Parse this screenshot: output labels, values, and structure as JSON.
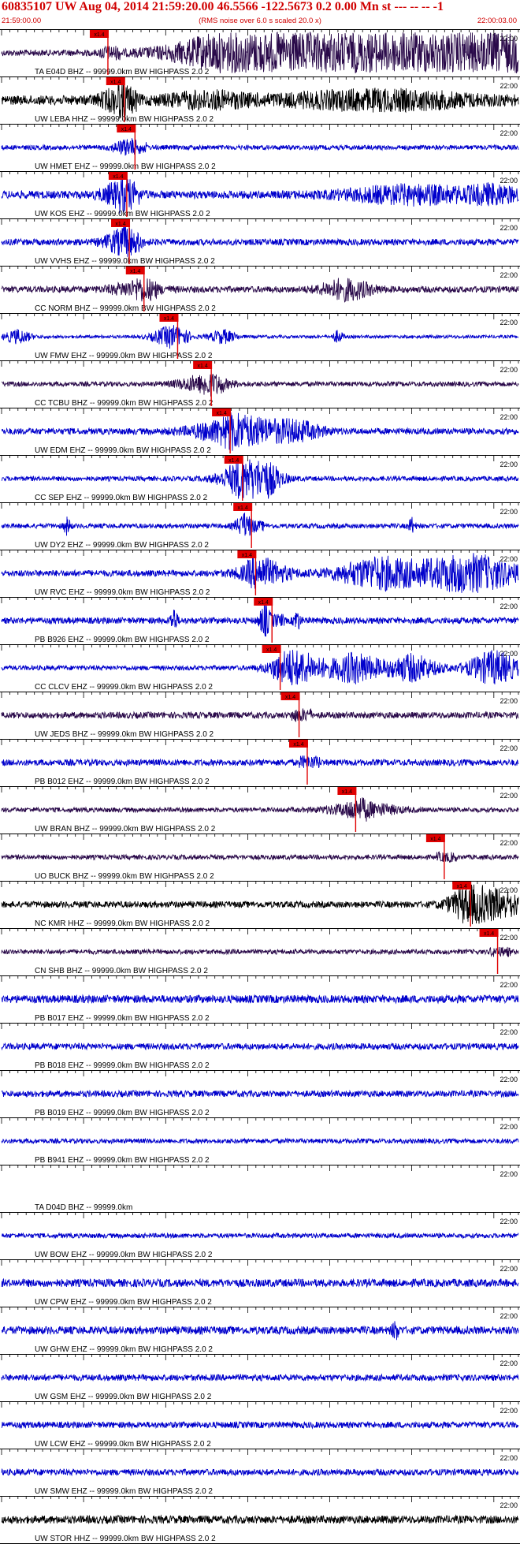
{
  "header": {
    "title": "60835107 UW Aug 04, 2014 21:59:20.00   46.5566 -122.5673  0.2 0.00 Mn st --- -- --   -1",
    "start_time": "21:59:00.00",
    "subtitle": "(RMS noise over 6.0 s scaled 20.0 x)",
    "end_time": "22:00:03.00"
  },
  "colors": {
    "title": "#d00000",
    "pick": "#e00000",
    "dark": "#2a0a4a",
    "blue": "#0000cc",
    "black": "#000000"
  },
  "pick_label": "x1.4",
  "right_time": "22:00",
  "chart_data": {
    "type": "line",
    "title": "60835107 UW Aug 04, 2014 21:59:20.00   46.5566 -122.5673  0.2 0.00 Mn st --- -- --   -1",
    "x_range": [
      "21:59:00.00",
      "22:00:03.00"
    ],
    "x_unit": "seconds after 21:59:00.00",
    "x_max": 63,
    "traces": [
      {
        "label": "TA E04D BHZ -- 99999.0km BW  HIGHPASS  2.0  2",
        "color": "dark",
        "pick": 12.0,
        "amp": 4,
        "events": [
          [
            31,
            9,
            30
          ],
          [
            46,
            11,
            55
          ],
          [
            60,
            3,
            40
          ]
        ]
      },
      {
        "label": "UW LEBA HHZ -- 99999.0km BW  HIGHPASS  2.0  2",
        "color": "black",
        "pick": 14.0,
        "amp": 6,
        "events": [
          [
            14,
            2,
            12
          ],
          [
            25,
            5,
            8
          ],
          [
            46,
            12,
            10
          ]
        ]
      },
      {
        "label": "UW HMET EHZ -- 99999.0km BW  HIGHPASS  2.0  2",
        "color": "blue",
        "pick": 15.3,
        "amp": 3,
        "events": [
          [
            15,
            1.5,
            8
          ]
        ]
      },
      {
        "label": "UW KOS EHZ -- 99999.0km BW  HIGHPASS  2.0  2",
        "color": "blue",
        "pick": 14.3,
        "amp": 5,
        "events": [
          [
            14.3,
            2,
            14
          ],
          [
            50,
            8,
            10
          ],
          [
            60,
            3,
            9
          ]
        ]
      },
      {
        "label": "UW VVHS EHZ -- 99999.0km BW  HIGHPASS  2.0  2",
        "color": "blue",
        "pick": 14.6,
        "amp": 4,
        "events": [
          [
            14.6,
            2,
            14
          ]
        ]
      },
      {
        "label": "CC NORM BHZ -- 99999.0km BW  HIGHPASS  2.0  2",
        "color": "dark",
        "pick": 16.4,
        "amp": 4,
        "events": [
          [
            16.4,
            3,
            8
          ],
          [
            42,
            3,
            12
          ]
        ]
      },
      {
        "label": "UW FMW EHZ -- 99999.0km BW  HIGHPASS  2.0  2",
        "color": "blue",
        "pick": 20.5,
        "amp": 2,
        "events": [
          [
            2,
            1.5,
            8
          ],
          [
            20.5,
            2,
            12
          ],
          [
            27,
            1.5,
            8
          ],
          [
            41,
            0.6,
            7
          ]
        ]
      },
      {
        "label": "CC TCBU BHZ -- 99999.0km BW  HIGHPASS  2.0  2",
        "color": "dark",
        "pick": 24.6,
        "amp": 3,
        "events": [
          [
            24.6,
            3,
            10
          ]
        ]
      },
      {
        "label": "UW EDM EHZ -- 99999.0km BW  HIGHPASS  2.0  2",
        "color": "blue",
        "pick": 26.9,
        "amp": 4,
        "events": [
          [
            29,
            5,
            18
          ],
          [
            36,
            3,
            10
          ]
        ]
      },
      {
        "label": "CC SEP EHZ -- 99999.0km BW  HIGHPASS  2.0  2",
        "color": "blue",
        "pick": 28.4,
        "amp": 3,
        "events": [
          [
            30,
            3,
            24
          ],
          [
            32,
            2,
            12
          ]
        ]
      },
      {
        "label": "UW DY2 EHZ -- 99999.0km BW  HIGHPASS  2.0  2",
        "color": "blue",
        "pick": 29.5,
        "amp": 3,
        "events": [
          [
            29.5,
            1,
            12
          ],
          [
            8,
            0.4,
            10
          ],
          [
            50,
            0.4,
            9
          ]
        ]
      },
      {
        "label": "UW RVC EHZ -- 99999.0km BW  HIGHPASS  2.0  2",
        "color": "blue",
        "pick": 30.0,
        "amp": 4,
        "events": [
          [
            32,
            3,
            14
          ],
          [
            46,
            5,
            18
          ],
          [
            57,
            6,
            22
          ]
        ]
      },
      {
        "label": "PB B926 EHZ -- 99999.0km BW  HIGHPASS  2.0  2",
        "color": "blue",
        "pick": 32.0,
        "amp": 4,
        "events": [
          [
            21,
            0.4,
            14
          ],
          [
            32,
            0.6,
            16
          ],
          [
            36,
            0.4,
            12
          ]
        ]
      },
      {
        "label": "CC CLCV EHZ -- 99999.0km BW  HIGHPASS  2.0  2",
        "color": "blue",
        "pick": 33.0,
        "amp": 3,
        "events": [
          [
            36,
            3,
            20
          ],
          [
            43,
            3,
            18
          ],
          [
            50,
            3,
            16
          ],
          [
            60,
            3,
            20
          ]
        ]
      },
      {
        "label": "UW JEDS BHZ -- 99999.0km BW  HIGHPASS  2.0  2",
        "color": "dark",
        "pick": 35.3,
        "amp": 4,
        "events": []
      },
      {
        "label": "PB B012 EHZ -- 99999.0km BW  HIGHPASS  2.0  2",
        "color": "blue",
        "pick": 36.3,
        "amp": 4,
        "events": []
      },
      {
        "label": "UW BRAN BHZ -- 99999.0km BW  HIGHPASS  2.0  2",
        "color": "dark",
        "pick": 42.2,
        "amp": 3,
        "events": [
          [
            44,
            4,
            9
          ]
        ]
      },
      {
        "label": "UO BUCK BHZ -- 99999.0km BW  HIGHPASS  2.0  2",
        "color": "dark",
        "pick": 53.0,
        "amp": 3,
        "events": []
      },
      {
        "label": "NC KMR HHZ -- 99999.0km BW  HIGHPASS  2.0  2",
        "color": "black",
        "pick": 56.2,
        "amp": 4,
        "events": [
          [
            57,
            2.5,
            20
          ],
          [
            61,
            2.5,
            16
          ]
        ]
      },
      {
        "label": "CN SHB BHZ -- 99999.0km BW  HIGHPASS  2.0  2",
        "color": "dark",
        "pick": 59.5,
        "amp": 3,
        "events": []
      },
      {
        "label": "PB B017 EHZ -- 99999.0km BW  HIGHPASS  2.0  2",
        "color": "blue",
        "pick": null,
        "amp": 5,
        "events": []
      },
      {
        "label": "PB B018 EHZ -- 99999.0km BW  HIGHPASS  2.0  2",
        "color": "blue",
        "pick": null,
        "amp": 4,
        "events": []
      },
      {
        "label": "PB B019 EHZ -- 99999.0km BW  HIGHPASS  2.0  2",
        "color": "blue",
        "pick": null,
        "amp": 4,
        "events": []
      },
      {
        "label": "PB B941 EHZ -- 99999.0km BW  HIGHPASS  2.0  2",
        "color": "blue",
        "pick": null,
        "amp": 3,
        "events": []
      },
      {
        "label": "TA D04D BHZ -- 99999.0km",
        "color": "blue",
        "pick": null,
        "amp": 0,
        "events": []
      },
      {
        "label": "UW BOW EHZ -- 99999.0km BW  HIGHPASS  2.0  2",
        "color": "blue",
        "pick": null,
        "amp": 3,
        "events": []
      },
      {
        "label": "UW CPW EHZ -- 99999.0km BW  HIGHPASS  2.0  2",
        "color": "blue",
        "pick": null,
        "amp": 5,
        "events": []
      },
      {
        "label": "UW GHW EHZ -- 99999.0km BW  HIGHPASS  2.0  2",
        "color": "blue",
        "pick": null,
        "amp": 5,
        "events": [
          [
            48,
            0.4,
            10
          ]
        ]
      },
      {
        "label": "UW GSM EHZ -- 99999.0km BW  HIGHPASS  2.0  2",
        "color": "blue",
        "pick": null,
        "amp": 4,
        "events": []
      },
      {
        "label": "UW LCW EHZ -- 99999.0km BW  HIGHPASS  2.0  2",
        "color": "blue",
        "pick": null,
        "amp": 4,
        "events": []
      },
      {
        "label": "UW SMW EHZ -- 99999.0km BW  HIGHPASS  2.0  2",
        "color": "blue",
        "pick": null,
        "amp": 4,
        "events": []
      },
      {
        "label": "UW STOR HHZ -- 99999.0km BW  HIGHPASS  2.0  2",
        "color": "black",
        "pick": null,
        "amp": 5,
        "events": []
      }
    ]
  }
}
